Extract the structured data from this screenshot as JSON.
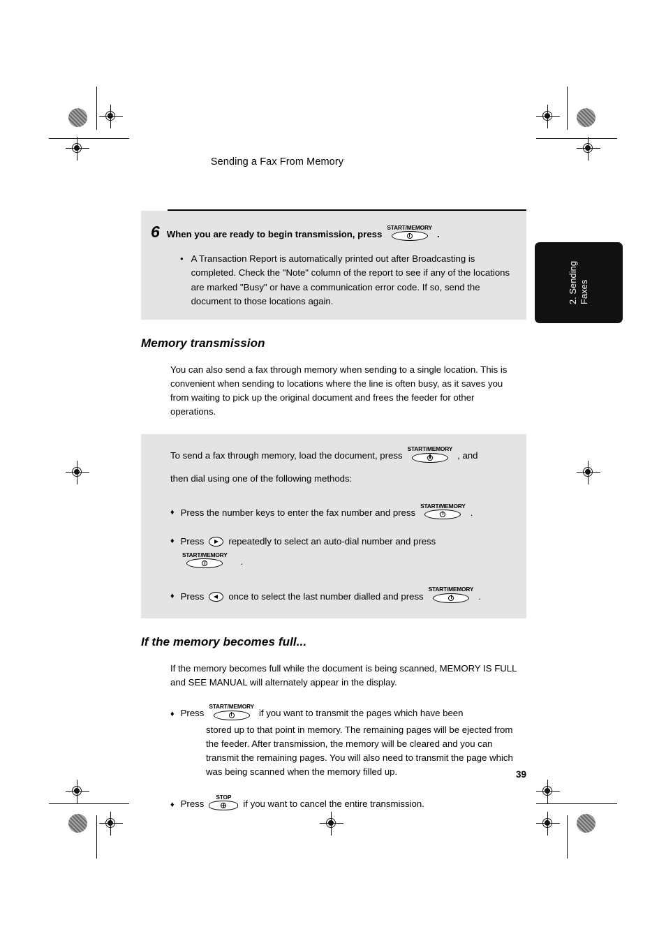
{
  "header": {
    "running_head": "Sending a Fax From Memory"
  },
  "side_tab": {
    "label": "2. Sending\nFaxes",
    "color": "#111111"
  },
  "keys": {
    "start_memory": "START/MEMORY",
    "stop": "STOP"
  },
  "step6": {
    "number": "6",
    "heading_before": "When you are ready to begin transmission, press",
    "heading_after": ".",
    "bullet_dot": "•",
    "bullet_text": "A Transaction Report is automatically printed out after Broadcasting is completed. Check the \"Note\" column of the report to see if any of the locations are marked \"Busy\" or have a communication error code. If so, send the document to those locations again."
  },
  "memory_transmission": {
    "title": "Memory transmission",
    "body": "You can also send a fax through memory when sending to a single location. This is convenient when sending to locations where the line is often busy, as it saves you from waiting to pick up the original document and frees the feeder for other operations.",
    "intro_before": "To send a fax through memory, load the document, press",
    "intro_after": ", and",
    "intro_line2": "then dial using one of the following methods:",
    "methods": [
      {
        "diamond": "♦",
        "before": "Press the number keys to enter the fax number and press",
        "after": "."
      },
      {
        "diamond": "♦",
        "before": "Press",
        "arrow": "arrow-right-icon",
        "middle": "repeatedly to select an auto-dial number and press",
        "after": "."
      },
      {
        "diamond": "♦",
        "before": "Press",
        "arrow": "arrow-left-icon",
        "middle": "once to select the last number dialled and press",
        "after": "."
      }
    ]
  },
  "memory_full": {
    "title": "If the memory becomes full...",
    "body": "If the memory becomes full while the document is being scanned, MEMORY IS FULL and SEE MANUAL will alternately appear in the display.",
    "items": [
      {
        "diamond": "♦",
        "before": "Press",
        "after": "if you want to transmit the pages which have been",
        "continuation": "stored up to that point in memory. The remaining pages will be ejected from the feeder. After transmission, the memory will be cleared and you can transmit the remaining pages. You will also need to transmit the page which was being scanned when the memory filled up."
      },
      {
        "diamond": "♦",
        "before": "Press",
        "after": "if you want to cancel the entire transmission."
      }
    ]
  },
  "footer": {
    "page_number": "39"
  }
}
